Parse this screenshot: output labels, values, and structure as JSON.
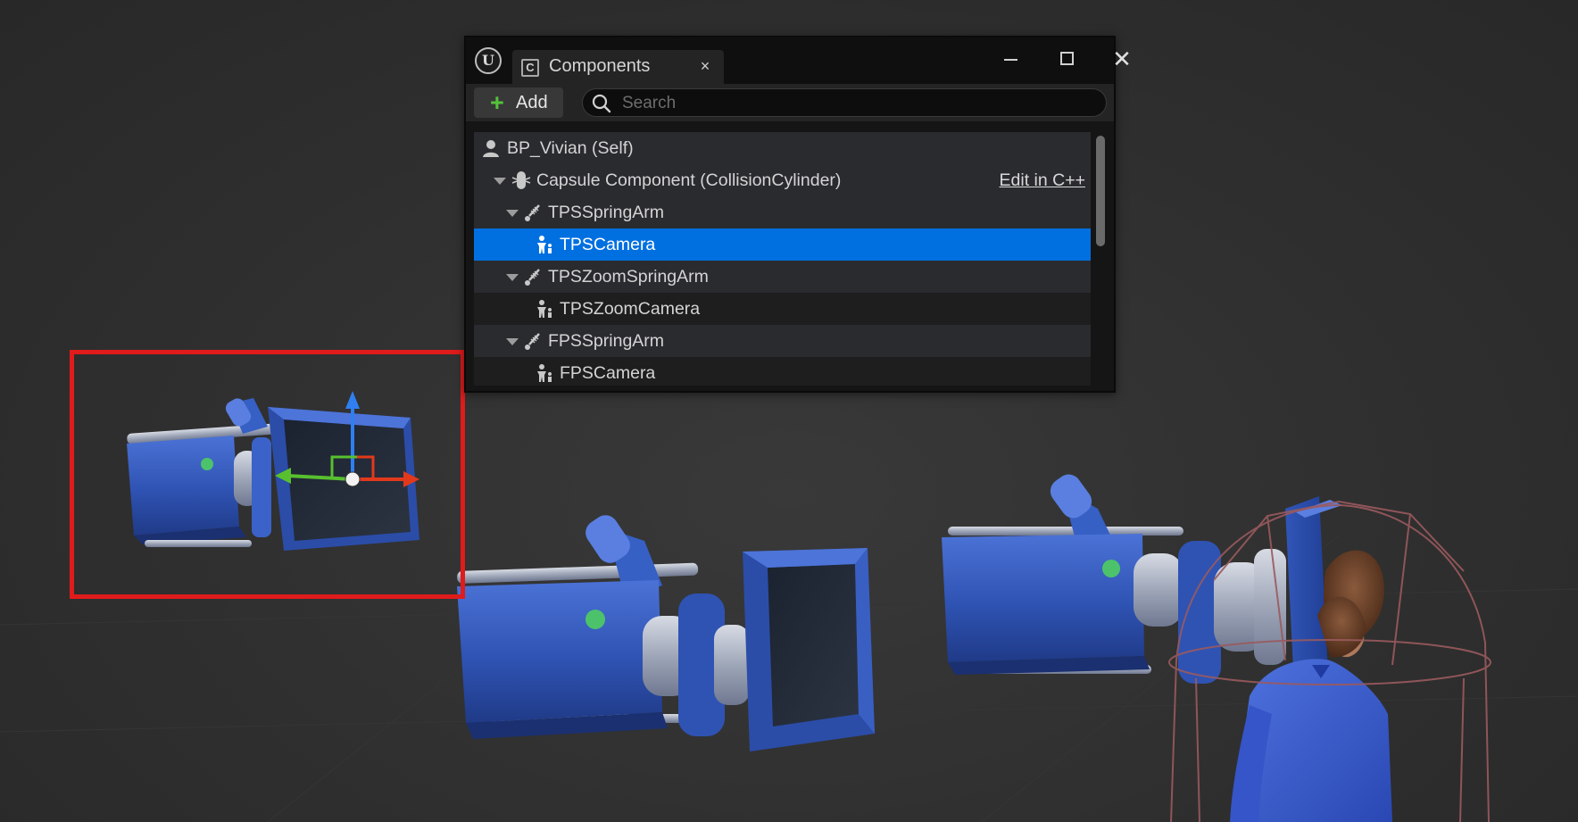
{
  "panel": {
    "tab_title": "Components",
    "tab_icon_glyph": "C",
    "logo_glyph": "U",
    "close_tab_glyph": "×",
    "close_window_glyph": "✕"
  },
  "toolbar": {
    "add_label": "Add",
    "add_glyph": "+",
    "search_placeholder": "Search"
  },
  "tree": {
    "rows": [
      {
        "label": "BP_Vivian (Self)",
        "icon": "character-icon"
      },
      {
        "label": "Capsule Component (CollisionCylinder)",
        "icon": "capsule-icon",
        "action": "Edit in C++"
      },
      {
        "label": "TPSSpringArm",
        "icon": "spring-arm-icon"
      },
      {
        "label": "TPSCamera",
        "icon": "camera-component-icon",
        "selected": true
      },
      {
        "label": "TPSZoomSpringArm",
        "icon": "spring-arm-icon"
      },
      {
        "label": "TPSZoomCamera",
        "icon": "camera-component-icon"
      },
      {
        "label": "FPSSpringArm",
        "icon": "spring-arm-icon"
      },
      {
        "label": "FPSCamera",
        "icon": "camera-component-icon"
      }
    ]
  },
  "colors": {
    "selection": "#0070e0",
    "highlight_box": "#e01b1b",
    "add_plus": "#55c23c",
    "camera_body": "#2f53b3"
  }
}
